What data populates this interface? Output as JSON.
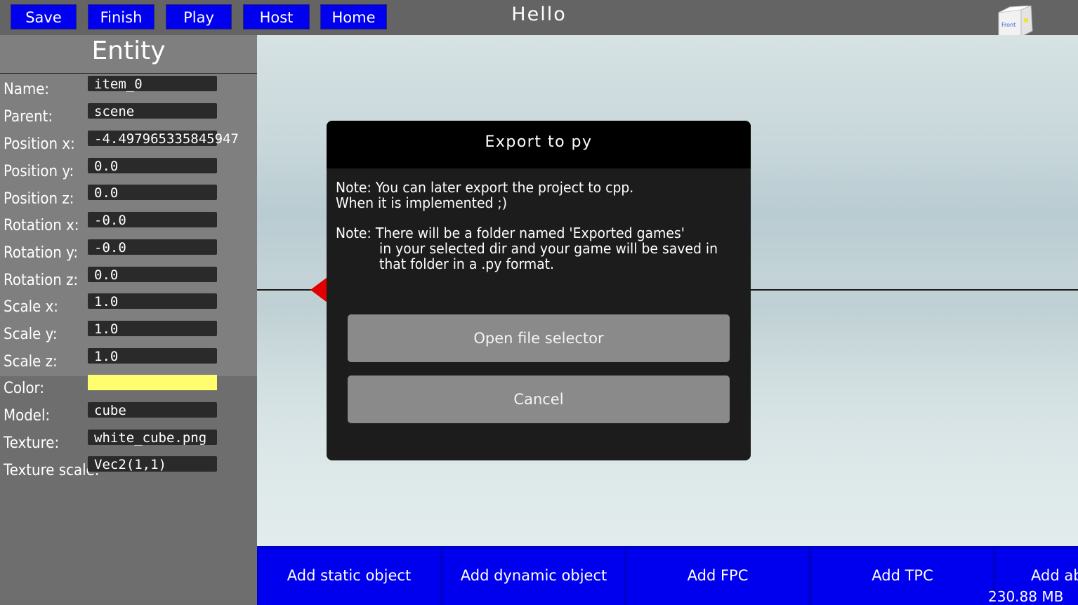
{
  "toolbar": {
    "buttons": [
      "Save",
      "Finish",
      "Play",
      "Host",
      "Home"
    ],
    "title": "Hello"
  },
  "view_cube": {
    "face_label": "Front"
  },
  "entity_panel": {
    "title": "Entity",
    "fields": [
      {
        "label": "Name:",
        "value": "item_0"
      },
      {
        "label": "Parent:",
        "value": "scene"
      },
      {
        "label": "Position x:",
        "value": "-4.497965335845947"
      },
      {
        "label": "Position y:",
        "value": "0.0"
      },
      {
        "label": "Position z:",
        "value": "0.0"
      },
      {
        "label": "Rotation x:",
        "value": "-0.0"
      },
      {
        "label": "Rotation y:",
        "value": "-0.0"
      },
      {
        "label": "Rotation z:",
        "value": "0.0"
      },
      {
        "label": "Scale x:",
        "value": "1.0"
      },
      {
        "label": "Scale y:",
        "value": "1.0"
      },
      {
        "label": "Scale z:",
        "value": "1.0"
      }
    ],
    "color": {
      "label": "Color:",
      "value": "#ffff6e"
    },
    "model": {
      "label": "Model:",
      "value": "cube"
    },
    "texture": {
      "label": "Texture:",
      "value": "white_cube.png"
    },
    "texture_scale": {
      "label": "Texture scale:",
      "value": "Vec2(1,1)"
    }
  },
  "dialog": {
    "title": "Export to py",
    "note1_line1": "Note: You can later export the project to cpp.",
    "note1_line2": "When it is implemented ;)",
    "note2_line1": "Note: There will be a folder named 'Exported games'",
    "note2_line2": "in your selected dir and your game will be saved in",
    "note2_line3": "that folder in a .py format.",
    "open_button": "Open file selector",
    "cancel_button": "Cancel"
  },
  "bottom_bar": {
    "buttons": [
      "Add static object",
      "Add dynamic object",
      "Add FPC",
      "Add TPC",
      "Add ab"
    ]
  },
  "memory_usage": "230.88 MB",
  "colors": {
    "button_blue": "#0000ee",
    "dialog_bg": "#1c1c1c",
    "gizmo_red": "#e00000"
  }
}
